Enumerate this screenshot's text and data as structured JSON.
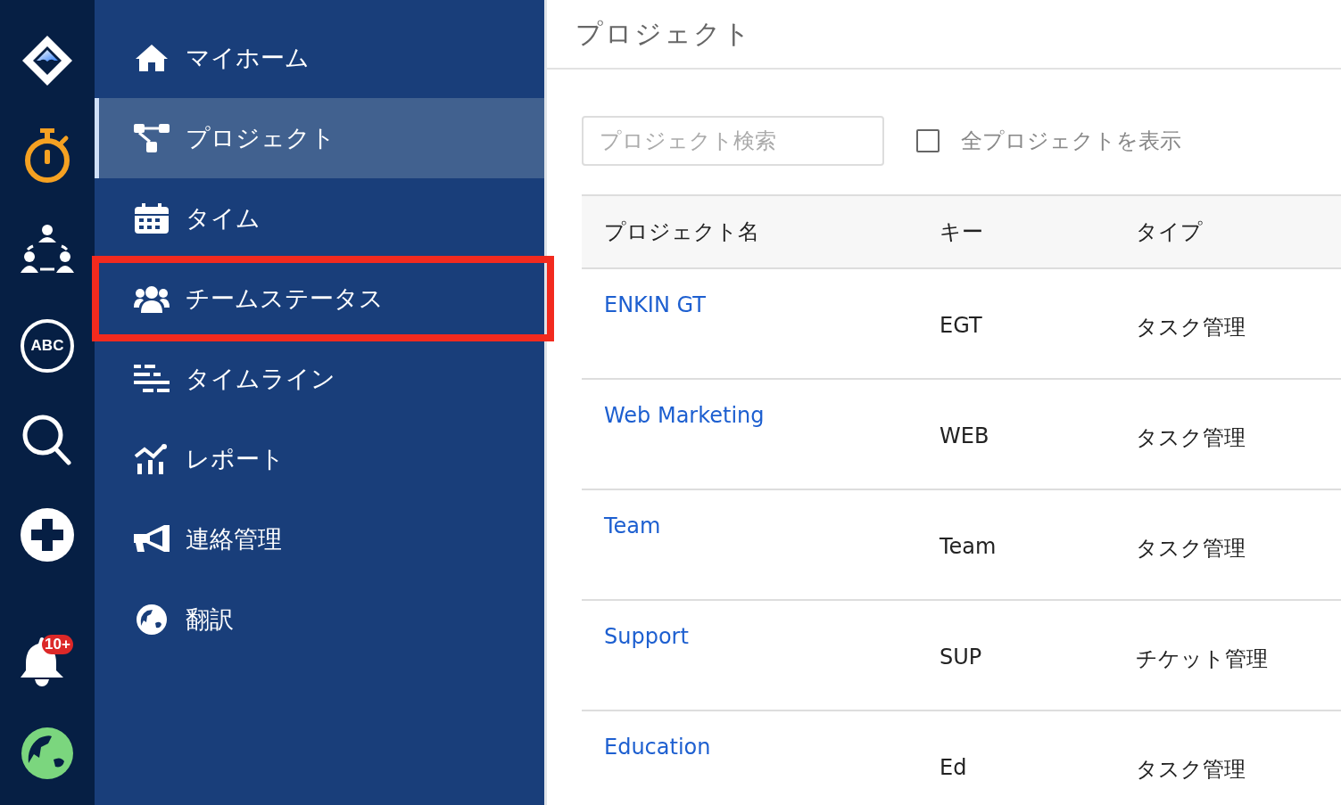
{
  "rail": {
    "notification_badge": "10+",
    "abc_label": "ABC"
  },
  "sidebar": {
    "items": [
      {
        "kind": "home",
        "label": "マイホーム",
        "selected": false,
        "highlighted": false
      },
      {
        "kind": "project",
        "label": "プロジェクト",
        "selected": true,
        "highlighted": false
      },
      {
        "kind": "calendar",
        "label": "タイム",
        "selected": false,
        "highlighted": false
      },
      {
        "kind": "team",
        "label": "チームステータス",
        "selected": false,
        "highlighted": true
      },
      {
        "kind": "timeline",
        "label": "タイムライン",
        "selected": false,
        "highlighted": false
      },
      {
        "kind": "report",
        "label": "レポート",
        "selected": false,
        "highlighted": false
      },
      {
        "kind": "megaphone",
        "label": "連絡管理",
        "selected": false,
        "highlighted": false
      },
      {
        "kind": "globe",
        "label": "翻訳",
        "selected": false,
        "highlighted": false
      }
    ]
  },
  "page": {
    "title": "プロジェクト"
  },
  "search": {
    "placeholder": "プロジェクト検索"
  },
  "show_all": {
    "label": "全プロジェクトを表示",
    "checked": false
  },
  "table": {
    "columns": [
      "プロジェクト名",
      "キー",
      "タイプ"
    ],
    "rows": [
      {
        "name": "ENKIN GT",
        "key": "EGT",
        "type": "タスク管理"
      },
      {
        "name": "Web Marketing",
        "key": "WEB",
        "type": "タスク管理"
      },
      {
        "name": "Team",
        "key": "Team",
        "type": "タスク管理"
      },
      {
        "name": "Support",
        "key": "SUP",
        "type": "チケット管理"
      },
      {
        "name": "Education",
        "key": "Ed",
        "type": "タスク管理"
      }
    ]
  }
}
